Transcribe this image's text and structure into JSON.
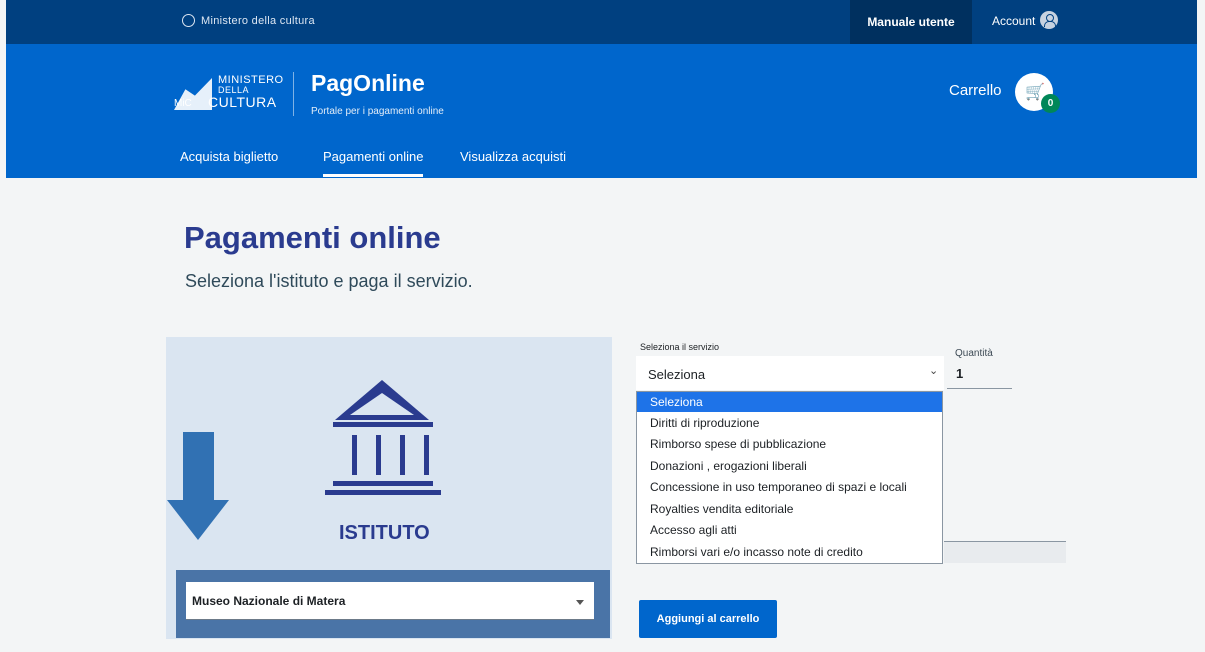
{
  "topbar": {
    "ministry": "Ministero della cultura",
    "manual": "Manuale utente",
    "account": "Account"
  },
  "header": {
    "logo": {
      "line1": "MINISTERO",
      "line2": "DELLA",
      "line3": "CULTURA",
      "mic": "MiC"
    },
    "brand": "PagOnline",
    "brand_sub": "Portale per i pagamenti online",
    "cart_label": "Carrello",
    "cart_count": "0",
    "nav": [
      {
        "label": "Acquista biglietto",
        "active": false
      },
      {
        "label": "Pagamenti online",
        "active": true
      },
      {
        "label": "Visualizza acquisti",
        "active": false
      }
    ]
  },
  "page": {
    "title": "Pagamenti online",
    "subtitle": "Seleziona l'istituto e paga il servizio."
  },
  "istituto": {
    "label": "ISTITUTO",
    "selected": "Museo Nazionale di Matera"
  },
  "servizio": {
    "label": "Seleziona il servizio",
    "value": "Seleziona",
    "options": [
      "Seleziona",
      "Diritti di riproduzione",
      "Rimborso spese di pubblicazione",
      "Donazioni , erogazioni liberali",
      "Concessione in uso temporaneo di spazi e locali",
      "Royalties vendita editoriale",
      "Accesso agli atti",
      "Rimborsi vari e/o incasso note di credito"
    ],
    "highlighted_index": 0
  },
  "quantita": {
    "label": "Quantità",
    "value": "1"
  },
  "add_button": "Aggiungi al carrello",
  "colors": {
    "header": "#0066cc",
    "topbar": "#004080",
    "accent": "#2a3b8f",
    "selection": "#1e73e8"
  }
}
